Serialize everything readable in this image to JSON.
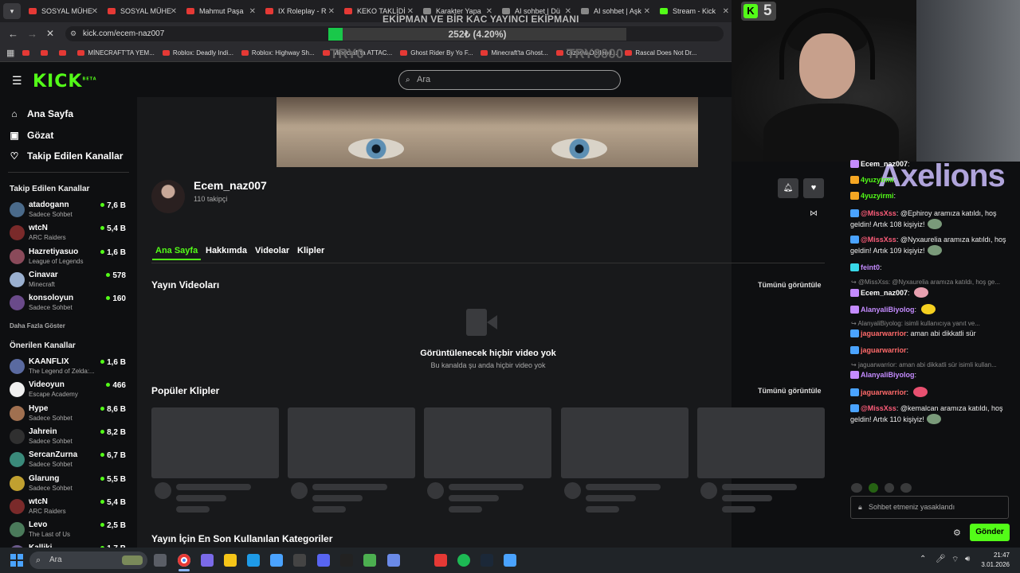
{
  "browser": {
    "tabs": [
      {
        "label": "SOSYAL MÜHE",
        "color": "#e53935"
      },
      {
        "label": "SOSYAL MÜHE",
        "color": "#e53935"
      },
      {
        "label": "Mahmut Paşa",
        "color": "#e53935"
      },
      {
        "label": "IX Roleplay - R",
        "color": "#e53935"
      },
      {
        "label": "KEKO TAKLİDİ",
        "color": "#e53935"
      },
      {
        "label": "Karakter Yapa",
        "color": "#888888"
      },
      {
        "label": "AI sohbet | Dü",
        "color": "#888888"
      },
      {
        "label": "AI sohbet | Aşk",
        "color": "#888888"
      },
      {
        "label": "Stream - Kick",
        "color": "#53fc18"
      }
    ],
    "url": "kick.com/ecem-naz007",
    "bookmarks": [
      "MİNECRAFT'TA YEM...",
      "Roblox: Deadly Indi...",
      "Roblox: Highway Sh...",
      "Minecraft'ta ATTAC...",
      "Ghost Rider By Yo F...",
      "Minecraft'ta Ghost...",
      "Gizemli Derlend...",
      "Rascal Does Not Dr..."
    ]
  },
  "overlay": {
    "title": "EKİPMAN VE BİR KAÇ YAYINCI EKİPMANI",
    "progress_label": "252₺ (4.20%)",
    "progress_percent": 4.2,
    "try_left": "TRY0",
    "try_right": "TRY6000",
    "kick_badge": "5",
    "watermark": "Axelions"
  },
  "search": {
    "placeholder": "Ara"
  },
  "sidebar": {
    "nav": [
      {
        "label": "Ana Sayfa",
        "icon": "home-icon"
      },
      {
        "label": "Gözat",
        "icon": "browse-icon"
      },
      {
        "label": "Takip Edilen Kanallar",
        "icon": "heart-icon"
      }
    ],
    "followed_title": "Takip Edilen Kanallar",
    "followed": [
      {
        "name": "atadogann",
        "category": "Sadece Sohbet",
        "viewers": "7,6 B",
        "color": "#4a6a8a"
      },
      {
        "name": "wtcN",
        "category": "ARC Raiders",
        "viewers": "5,4 B",
        "color": "#7a2a2a"
      },
      {
        "name": "Hazretiyasuo",
        "category": "League of Legends",
        "viewers": "1,6 B",
        "color": "#8a4a5a"
      },
      {
        "name": "Cinavar",
        "category": "Minecraft",
        "viewers": "578",
        "color": "#9ab0d0"
      },
      {
        "name": "konsoloyun",
        "category": "Sadece Sohbet",
        "viewers": "160",
        "color": "#6a4a8a"
      }
    ],
    "show_more": "Daha Fazla Göster",
    "recommended_title": "Önerilen Kanallar",
    "recommended": [
      {
        "name": "KAANFLIX",
        "category": "The Legend of Zelda:...",
        "viewers": "1,6 B",
        "color": "#5a6aa0"
      },
      {
        "name": "Videoyun",
        "category": "Escape Academy",
        "viewers": "466",
        "color": "#f0f0f0"
      },
      {
        "name": "Hype",
        "category": "Sadece Sohbet",
        "viewers": "8,6 B",
        "color": "#a07050"
      },
      {
        "name": "Jahrein",
        "category": "Sadece Sohbet",
        "viewers": "8,2 B",
        "color": "#303030"
      },
      {
        "name": "SercanZurna",
        "category": "Sadece Sohbet",
        "viewers": "6,7 B",
        "color": "#3a8a7a"
      },
      {
        "name": "Glarung",
        "category": "Sadece Sohbet",
        "viewers": "5,5 B",
        "color": "#c0a030"
      },
      {
        "name": "wtcN",
        "category": "ARC Raiders",
        "viewers": "5,4 B",
        "color": "#7a2a2a"
      },
      {
        "name": "Levo",
        "category": "The Last of Us",
        "viewers": "2,5 B",
        "color": "#4a7a5a"
      },
      {
        "name": "Kalliki",
        "category": "",
        "viewers": "1,7 B",
        "color": "#6a5a8a"
      }
    ]
  },
  "channel": {
    "name": "Ecem_naz007",
    "followers": "110 takipçi",
    "tabs": [
      "Ana Sayfa",
      "Hakkımda",
      "Videolar",
      "Klipler"
    ],
    "videos_title": "Yayın Videoları",
    "see_all": "Tümünü görüntüle",
    "empty_title": "Görüntülenecek hiçbir video yok",
    "empty_sub": "Bu kanalda şu anda hiçbir video yok",
    "clips_title": "Popüler Klipler",
    "categories_title": "Yayın İçin En Son Kullanılan Kategoriler"
  },
  "chat": {
    "messages": [
      {
        "user": "Ecem_naz007",
        "text": "",
        "color": "#ffffff"
      },
      {
        "user": "4yuzyirmi",
        "text": "",
        "color": "#53fc18"
      },
      {
        "user": "4yuzyirmi",
        "text": "",
        "color": "#53fc18"
      },
      {
        "user": "@MissXss",
        "text": "@Ephiroy aramıza katıldı, hoş geldin! Artık 108 kişiyiz!",
        "color": "#ff5d7a"
      },
      {
        "user": "@MissXss",
        "text": "@Nyxaurelia aramıza katıldı, hoş geldin! Artık 109 kişiyiz!",
        "color": "#ff5d7a"
      },
      {
        "user": "feint0",
        "text": "",
        "color": "#c48bff"
      },
      {
        "user": "Ecem_naz007",
        "text": "",
        "color": "#ffffff"
      },
      {
        "user": "AlanyaliBiyolog",
        "text": "",
        "color": "#c48bff"
      },
      {
        "user": "jaguarwarrior",
        "text": "aman abi dikkatli sür",
        "color": "#ff6a6a"
      },
      {
        "user": "jaguarwarrior",
        "text": "",
        "color": "#ff6a6a"
      },
      {
        "user": "AlanyaliBiyolog",
        "text": "",
        "color": "#c48bff"
      },
      {
        "user": "jaguarwarrior",
        "text": "",
        "color": "#ff6a6a"
      },
      {
        "user": "@MissXss",
        "text": "@kemalcan aramıza katıldı, hoş geldin! Artık 110 kişiyiz!",
        "color": "#ff5d7a"
      }
    ],
    "replies": [
      "@MissXss: @Nyxaurelia aramıza katıldı, hoş ge...",
      "AlanyaliBiyolog: isimli kullanıcıya yanıt ve...",
      "jaguarwarrior: aman abi dikkatli sür isimli kullan..."
    ],
    "input_placeholder": "Sohbet etmeniz yasaklandı",
    "send_label": "Gönder"
  },
  "taskbar": {
    "search_placeholder": "Ara",
    "time": "21:47",
    "date": "3.01.2026"
  }
}
